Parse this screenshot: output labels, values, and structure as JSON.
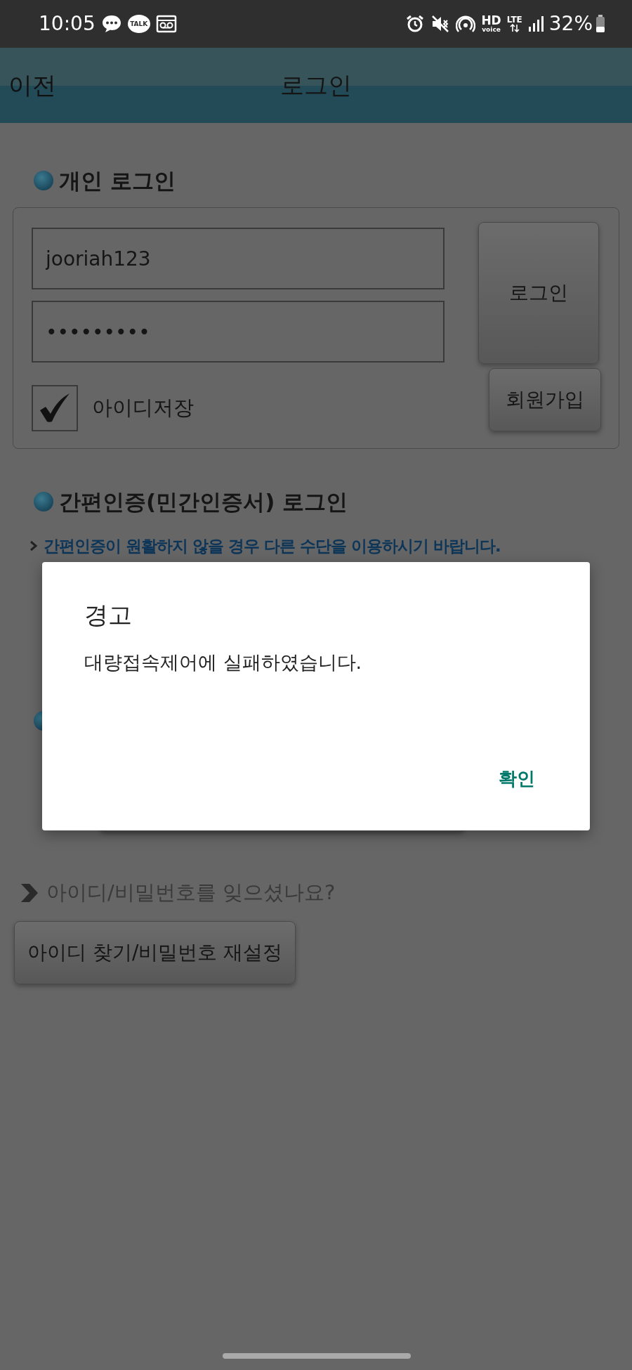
{
  "status_bar": {
    "time": "10:05",
    "talk": "TALK",
    "hd": "HD",
    "voice": "voice",
    "network": "LTE",
    "battery": "32%"
  },
  "header": {
    "back": "이전",
    "title": "로그인"
  },
  "personal_login": {
    "heading": "개인 로그인",
    "user_id": "jooriah123",
    "password": "•••••••••",
    "save_id": {
      "label": "아이디저장",
      "checked": true
    },
    "login_button": "로그인",
    "signup_button": "회원가입"
  },
  "simple_auth": {
    "heading": "간편인증(민간인증서) 로그인",
    "notice": "간편인증이 원활하지 않을 경우 다른 수단을 이용하시기 바랍니다."
  },
  "forgot": {
    "question": "아이디/비밀번호를 잊으셨나요?",
    "button": "아이디 찾기/비밀번호 재설정"
  },
  "dialog": {
    "title": "경고",
    "message": "대량접속제어에 실패하였습니다.",
    "button": "확인"
  }
}
